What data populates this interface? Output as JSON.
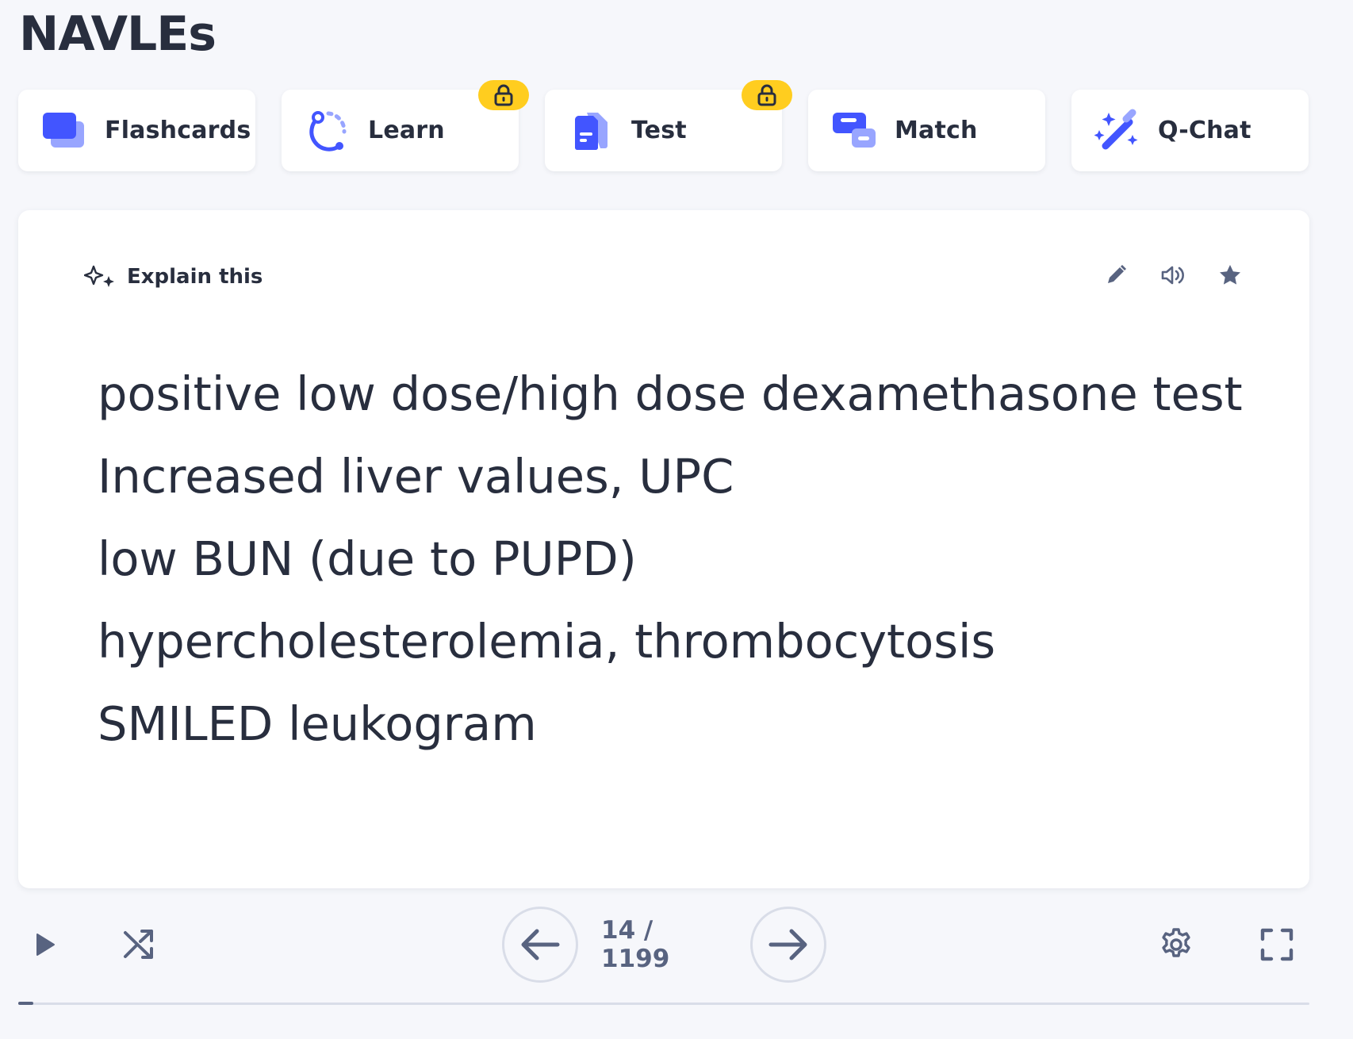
{
  "page": {
    "title": "NAVLEs"
  },
  "modes": [
    {
      "label": "Flashcards",
      "icon": "flashcards-icon",
      "locked": false
    },
    {
      "label": "Learn",
      "icon": "learn-icon",
      "locked": true
    },
    {
      "label": "Test",
      "icon": "test-icon",
      "locked": true
    },
    {
      "label": "Match",
      "icon": "match-icon",
      "locked": false
    },
    {
      "label": "Q-Chat",
      "icon": "magic-wand-icon",
      "locked": false
    }
  ],
  "card": {
    "explain_label": "Explain this",
    "actions": [
      "edit-icon",
      "audio-icon",
      "star-icon"
    ],
    "lines": [
      "positive low dose/high dose dexamethasone test",
      "Increased liver values, UPC",
      "low BUN (due to PUPD)",
      "hypercholesterolemia, thrombocytosis",
      "SMILED leukogram"
    ]
  },
  "controls": {
    "counter": "14 / 1199",
    "current": 14,
    "total": 1199
  },
  "progress": {
    "fraction": 0.0117
  },
  "colors": {
    "brand": "#4255ff",
    "brand_light": "#98a5ff",
    "lock": "#ffcd1f",
    "text": "#282e3e",
    "muted": "#586380",
    "background": "#f6f7fb"
  }
}
